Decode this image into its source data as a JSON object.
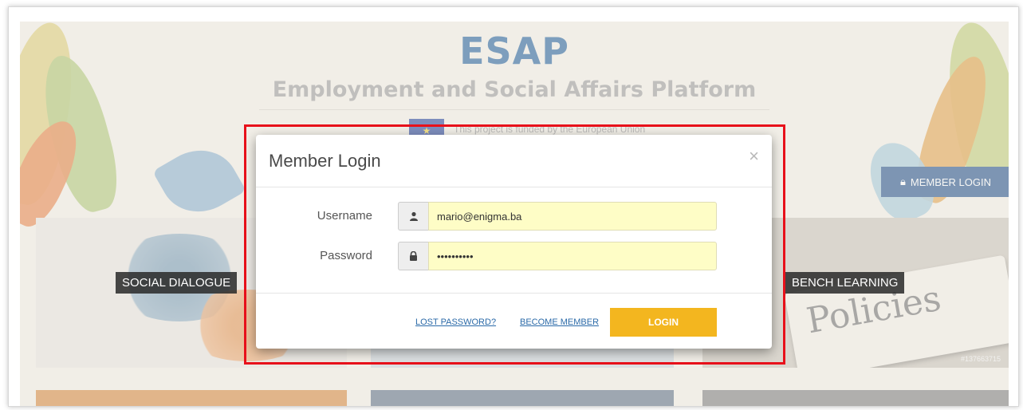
{
  "site": {
    "title": "ESAP",
    "subtitle": "Employment and Social Affairs Platform",
    "eu_notice": "This project is funded by the European Union",
    "member_login_label": "MEMBER LOGIN"
  },
  "tiles": [
    {
      "label": "SOCIAL DIALOGUE"
    },
    {
      "label": "BENCH LEARNING",
      "image_text": "Policies",
      "watermark": "#137663715"
    }
  ],
  "modal": {
    "title": "Member Login",
    "close_glyph": "×",
    "username": {
      "label": "Username",
      "value": "mario@enigma.ba"
    },
    "password": {
      "label": "Password",
      "value": "••••••••••"
    },
    "lost_password_label": "LOST PASSWORD?",
    "become_member_label": "BECOME MEMBER",
    "login_label": "LOGIN"
  },
  "icons": {
    "user": "user-icon",
    "lock": "lock-icon"
  },
  "colors": {
    "brand_blue": "#1f5e9a",
    "login_yellow": "#f3b61f",
    "highlight_red": "#e8111b",
    "autofill_yellow": "#fefdc6"
  }
}
